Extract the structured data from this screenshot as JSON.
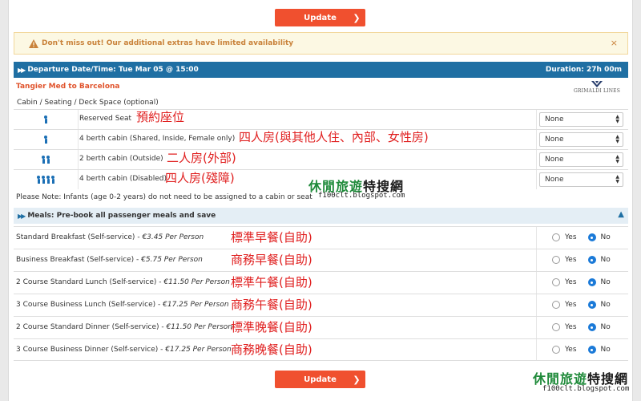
{
  "buttons": {
    "update_label": "Update",
    "update_icon": "chevron-right-icon"
  },
  "alert": {
    "text": "Don't miss out! Our additional extras have limited availability",
    "close": "×"
  },
  "departure": {
    "label": "Departure Date/Time: Tue Mar 05 @ 15:00",
    "duration": "Duration: 27h 00m"
  },
  "route": "Tangier Med to Barcelona",
  "operator_logo": "GRIMALDI LINES",
  "cabin_heading": "Cabin / Seating / Deck Space (optional)",
  "cabins": [
    {
      "people": 1,
      "label": "Reserved Seat",
      "selected": "None",
      "annotation": "預約座位"
    },
    {
      "people": 1,
      "label": "4 berth cabin (Shared, Inside, Female only)",
      "selected": "None",
      "annotation": "四人房(與其他人住、內部、女性房)"
    },
    {
      "people": 2,
      "label": "2 berth cabin (Outside)",
      "selected": "None",
      "annotation": "二人房(外部)"
    },
    {
      "people": 4,
      "label": "4 berth cabin (Disabled)",
      "selected": "None",
      "annotation": "四人房(殘障)"
    }
  ],
  "infant_note": "Please Note: Infants (age 0-2 years) do not need to be assigned to a cabin or seat",
  "meals_header": "Meals: Pre-book all passenger meals and save",
  "meals": [
    {
      "name": "Standard Breakfast (Self-service)",
      "price": "€3.45 Per Person",
      "choice": "No",
      "annotation": "標準早餐(自助)"
    },
    {
      "name": "Business Breakfast (Self-service)",
      "price": "€5.75 Per Person",
      "choice": "No",
      "annotation": "商務早餐(自助)"
    },
    {
      "name": "2 Course Standard Lunch (Self-service)",
      "price": "€11.50 Per Person",
      "choice": "No",
      "annotation": "標準午餐(自助)"
    },
    {
      "name": "3 Course Business Lunch (Self-service)",
      "price": "€17.25 Per Person",
      "choice": "No",
      "annotation": "商務午餐(自助)"
    },
    {
      "name": "2 Course Standard Dinner (Self-service)",
      "price": "€11.50 Per Person",
      "choice": "No",
      "annotation": "標準晚餐(自助)"
    },
    {
      "name": "3 Course Business Dinner (Self-service)",
      "price": "€17.25 Per Person",
      "choice": "No",
      "annotation": "商務晚餐(自助)"
    }
  ],
  "radio_labels": {
    "yes": "Yes",
    "no": "No"
  },
  "watermark": {
    "title_part1": "休閒",
    "title_part2": "旅遊",
    "title_part3": "特搜網",
    "url": "f100clt.blogspot.com"
  },
  "colors": {
    "accent": "#f0502f",
    "header_bar": "#1f6fa3",
    "annotation": "#e02020",
    "radio_selected": "#1b7ad8"
  }
}
